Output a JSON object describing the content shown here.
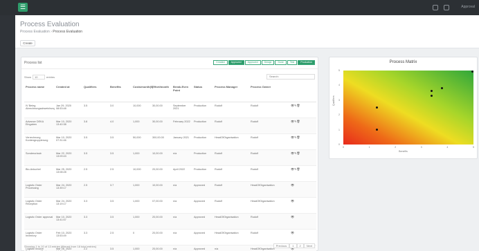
{
  "topbar": {
    "menu_icon": "☰",
    "user": "Approval"
  },
  "header": {
    "title": "Process Evaluation",
    "breadcrumb_home": "Process Evaluation",
    "breadcrumb_current": "Process Evaluation",
    "create_label": "Create"
  },
  "list": {
    "title": "Process list",
    "filters": [
      {
        "label": "Created",
        "active": false
      },
      {
        "label": "Approved",
        "active": true
      },
      {
        "label": "Approved",
        "active": false
      },
      {
        "label": "Design",
        "active": false
      },
      {
        "label": "Done",
        "active": false
      },
      {
        "label": "Test",
        "active": false
      },
      {
        "label": "Production",
        "active": true
      }
    ],
    "show_label": "Show",
    "show_value": "10",
    "show_suffix": "entries",
    "search_label": "Search:",
    "columns": [
      "Process name",
      "Created at",
      "Qualifiers",
      "Benefits",
      "Costs/month(€)",
      "Effort/month",
      "Break-Even Point",
      "Status",
      "Process Manager",
      "Process Owner",
      ""
    ],
    "rows": [
      [
        "IV Beleg Abrechnungsabweichungen",
        "Jan 29, 2020 08:53:48",
        "3.5",
        "3.0",
        "10,000",
        "30,00.00",
        "September 2021",
        "Production",
        "Rudolf",
        "Rudolf",
        "👁✎🗑"
      ],
      [
        "Advance DEKA Eingaben",
        "Mar 10, 2020 13:40:38",
        "3.8",
        "4.0",
        "1,000",
        "30,00.00",
        "February 2022",
        "Production",
        "Rudolf",
        "Rudolf",
        "👁✎🗑"
      ],
      [
        "Verrechnung Kontengruppierung",
        "Mar 10, 2020 07:31:46",
        "3.5",
        "3.5",
        "50,000",
        "300,00.00",
        "January 2021",
        "Production",
        "HeadOfOrganisation",
        "Rudolf",
        "👁✎🗑"
      ],
      [
        "Sonderurlaub",
        "Mar 22, 2020 13:09:43",
        "3.5",
        "3.5",
        "1,000",
        "10,00.00",
        "n/a",
        "Production",
        "Rudolf",
        "Rudolf",
        "👁✎🗑"
      ],
      [
        "Bio-Ankurbel",
        "Mar 25, 2020 13:08:28",
        "2.5",
        "2.5",
        "10,000",
        "20,00.00",
        "April 2022",
        "Production",
        "Rudolf",
        "Rudolf",
        "👁✎🗑"
      ],
      [
        "Logistic Order Processing",
        "Mar 24, 2020 13:39:17",
        "2.5",
        "3.7",
        "1,000",
        "10,00.00",
        "n/a",
        "Approved",
        "Rudolf",
        "HeadOfOrganisation",
        "👁"
      ],
      [
        "Logistic Order Reception",
        "Mar 24, 2020 13:19:17",
        "3.3",
        "3.5",
        "1,000",
        "07,00.00",
        "n/a",
        "Approved",
        "Rudolf",
        "HeadOfOrganisation",
        "👁"
      ],
      [
        "Logistic Order approval",
        "Mar 10, 2020 13:41:57",
        "3.3",
        "3.5",
        "1,000",
        "20,00.00",
        "n/a",
        "Approved",
        "HeadOfOrganisation",
        "Rudolf",
        "👁"
      ],
      [
        "Logistic Order Inventory",
        "Feb 10, 2020 13:53:49",
        "3.3",
        "2.5",
        "0",
        "20,00.00",
        "n/a",
        "Approved",
        "HeadOfOrganisation",
        "Rudolf",
        "👁"
      ],
      [
        "Logistic Invoice Procurement Test",
        "Mar 26, 2020 14:01:47",
        "2.2",
        "3.5",
        "1,000",
        "20,00.00",
        "n/a",
        "Approved",
        "n/a",
        "HeadOfOrganisation",
        "👁"
      ]
    ],
    "footer": "Showing 1 to 10 of 13 entries (filtered from 18 total entries)",
    "pager": [
      "Previous",
      "1",
      "2",
      "Next"
    ]
  },
  "matrix": {
    "title": "Process Matrix",
    "xlabel": "Benefits",
    "ylabel": "Qualifiers",
    "xticks": [
      "0",
      "1",
      "2",
      "3",
      "4",
      "5"
    ],
    "yticks": [
      "0",
      "1",
      "2",
      "3",
      "4",
      "5"
    ]
  },
  "chart_data": {
    "type": "scatter",
    "title": "Process Matrix",
    "xlabel": "Benefits",
    "ylabel": "Qualifiers",
    "xlim": [
      0,
      5
    ],
    "ylim": [
      0,
      5
    ],
    "grid": false,
    "points": [
      {
        "x": 1.3,
        "y": 2.5
      },
      {
        "x": 1.3,
        "y": 1.0
      },
      {
        "x": 3.4,
        "y": 3.6
      },
      {
        "x": 3.4,
        "y": 3.3
      },
      {
        "x": 3.8,
        "y": 3.8
      },
      {
        "x": 5.0,
        "y": 5.0
      }
    ]
  }
}
